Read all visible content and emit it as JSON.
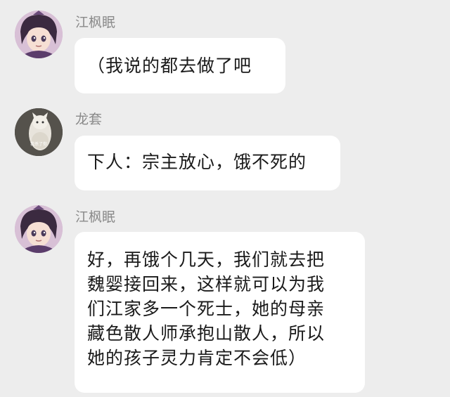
{
  "messages": [
    {
      "sender": "江枫眠",
      "avatar": "anime-character-avatar",
      "lines": [
        "（我说的都去做了吧"
      ]
    },
    {
      "sender": "龙套",
      "avatar": "cat-photo-avatar",
      "avatar_caption": "我杀了你",
      "lines": [
        "下人：宗主放心，饿不死的"
      ]
    },
    {
      "sender": "江枫眠",
      "avatar": "anime-character-avatar",
      "lines": [
        "好，再饿个几天，我们就去把",
        "魏婴接回来，这样就可以为我",
        "们江家多一个死士，她的母亲",
        "藏色散人师承抱山散人，所以",
        "她的孩子灵力肯定不会低）"
      ]
    }
  ],
  "colors": {
    "background": "#ededed",
    "bubble": "#ffffff",
    "sender_name": "#8a8a8a",
    "text": "#1a1a1a"
  }
}
